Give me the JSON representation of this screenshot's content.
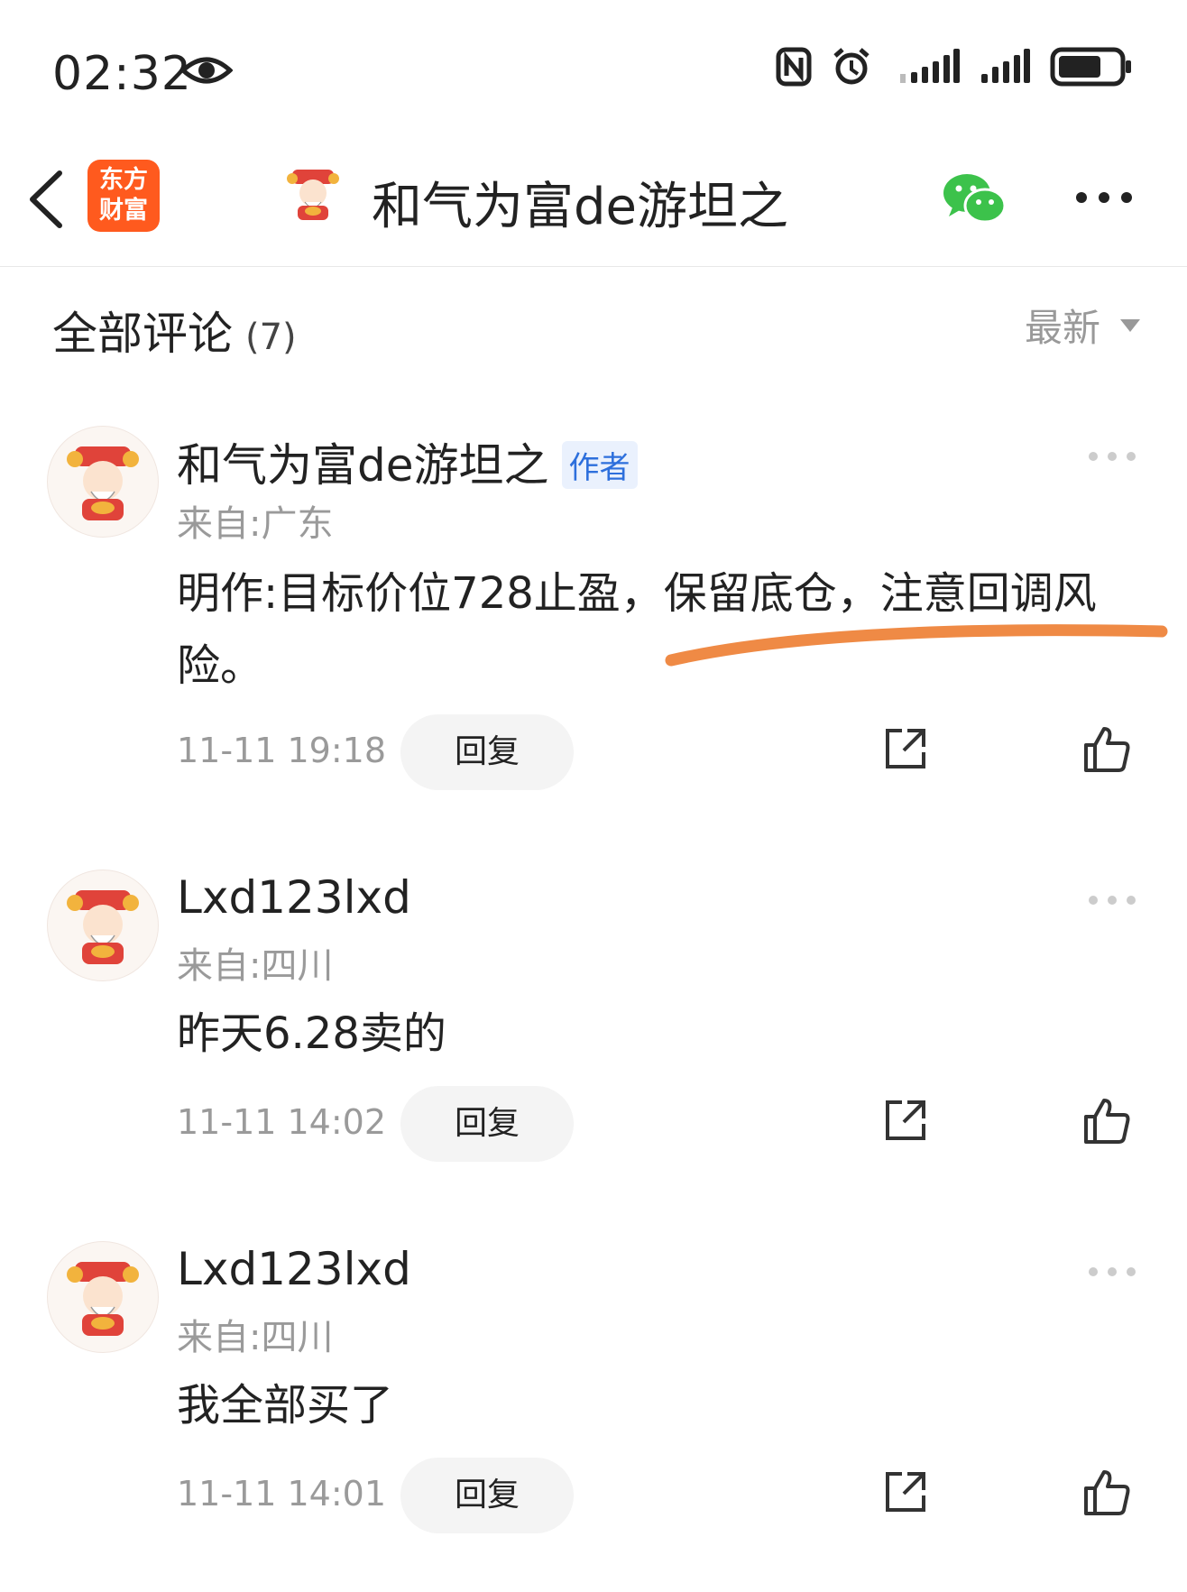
{
  "status_bar": {
    "time": "02:32"
  },
  "header": {
    "logo_line1": "东方",
    "logo_line2": "财富",
    "title": "和气为富de游坦之"
  },
  "comments_section": {
    "title": "全部评论",
    "count": "(7)",
    "sort_label": "最新"
  },
  "comments": [
    {
      "name": "和气为富de游坦之",
      "badge": "作者",
      "location": "来自:广东",
      "text": "明作:目标价位728止盈，保留底仓，注意回调风险。",
      "time": "11-11 19:18",
      "reply_label": "回复"
    },
    {
      "name": "Lxd123lxd",
      "location": "来自:四川",
      "text": "昨天6.28卖的",
      "time": "11-11 14:02",
      "reply_label": "回复"
    },
    {
      "name": "Lxd123lxd",
      "location": "来自:四川",
      "text": "我全部买了",
      "time": "11-11 14:01",
      "reply_label": "回复"
    }
  ],
  "colors": {
    "accent_orange": "#ff5a1e",
    "highlight_stroke": "#ef8a45",
    "badge_blue": "#2d6fdc",
    "wechat_green": "#3cc24b"
  }
}
